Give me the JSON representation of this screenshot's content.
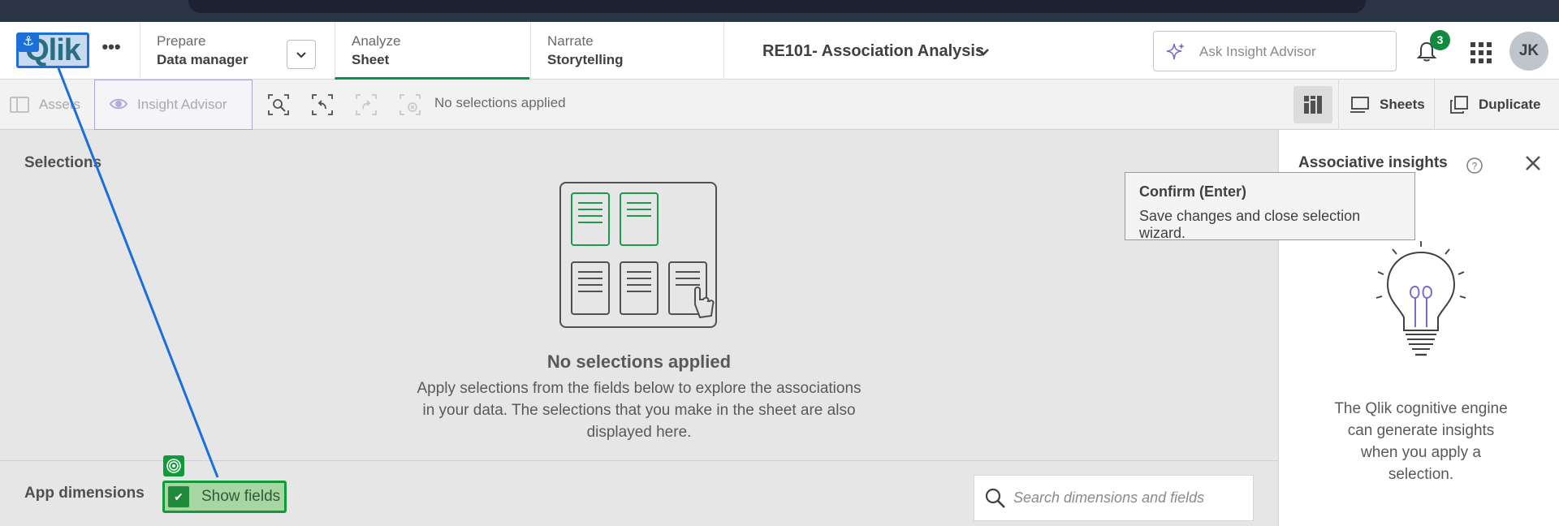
{
  "header": {
    "logo_text": "Qlik",
    "more_label": "•••",
    "tabs": [
      {
        "top": "Prepare",
        "bottom": "Data manager"
      },
      {
        "top": "Analyze",
        "bottom": "Sheet"
      },
      {
        "top": "Narrate",
        "bottom": "Storytelling"
      }
    ],
    "app_title": "RE101- Association Analysis",
    "ask_placeholder": "Ask Insight Advisor",
    "notification_count": "3",
    "avatar_initials": "JK"
  },
  "toolbar": {
    "assets_label": "Assets",
    "insight_advisor_label": "Insight Advisor",
    "no_selections_text": "No selections applied",
    "sheets_label": "Sheets",
    "duplicate_label": "Duplicate"
  },
  "main": {
    "selections_heading": "Selections",
    "empty_title": "No selections applied",
    "empty_description": "Apply selections from the fields below to explore the associations in your data. The selections that you make in the sheet are also displayed here.",
    "dimensions_heading": "App dimensions",
    "show_fields_label": "Show fields",
    "search_placeholder": "Search dimensions and fields"
  },
  "panel": {
    "title": "Associative insights",
    "description": "The Qlik cognitive engine can generate insights when you apply a selection."
  },
  "tooltip": {
    "title": "Confirm (Enter)",
    "body": "Save changes and close selection wizard."
  },
  "colors": {
    "accent_green": "#009845",
    "annotation_blue": "#1a6fd8",
    "badge_green": "#108a3c"
  },
  "icons": [
    "anchor-icon",
    "chevron-down-icon",
    "sparkle-icon",
    "bell-icon",
    "apps-grid-icon",
    "assets-panel-icon",
    "insight-eye-icon",
    "smart-search-icon",
    "step-back-icon",
    "step-forward-icon",
    "clear-selections-icon",
    "layout-icon",
    "sheets-icon",
    "duplicate-icon",
    "help-icon",
    "close-icon",
    "lightbulb-icon",
    "search-icon",
    "target-icon",
    "check-icon"
  ]
}
